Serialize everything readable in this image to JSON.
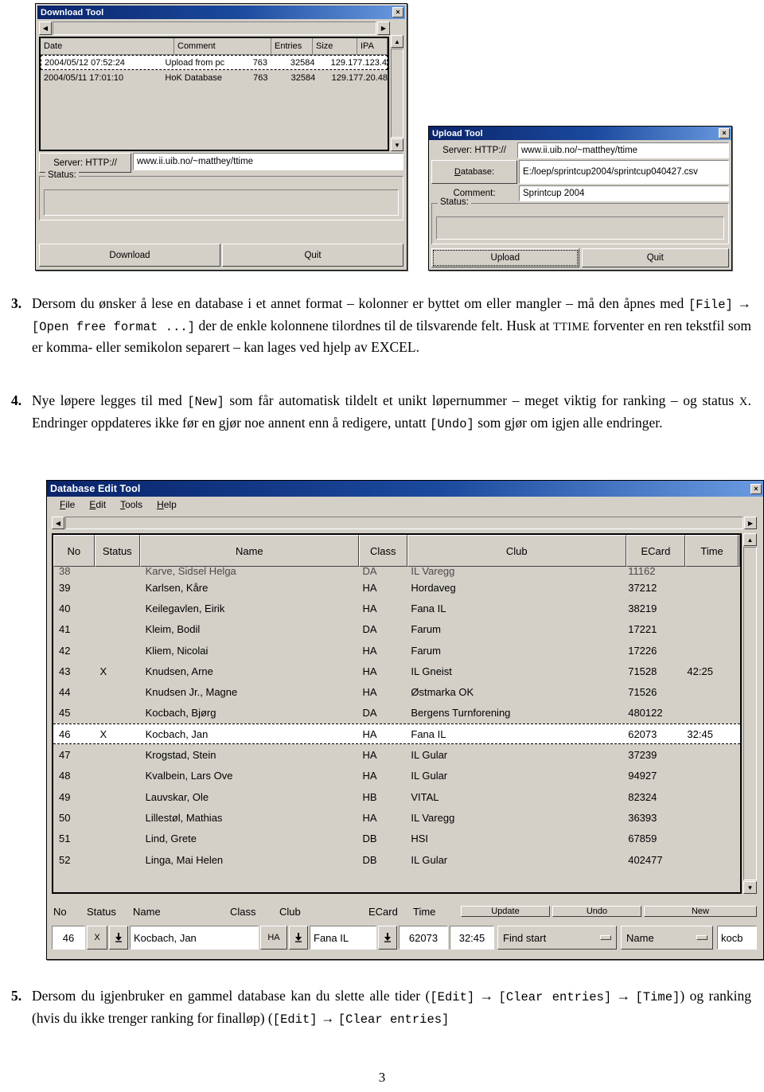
{
  "download_tool": {
    "title": "Download Tool",
    "close_label": "×",
    "columns": [
      "Date",
      "Comment",
      "Entries",
      "Size",
      "IPA"
    ],
    "rows": [
      {
        "date": "2004/05/12 07:52:24",
        "comment": "Upload from pc",
        "entries": "763",
        "size": "32584",
        "ipa": "129.177.123.4",
        "selected": true
      },
      {
        "date": "2004/05/11 17:01:10",
        "comment": "HoK Database",
        "entries": "763",
        "size": "32584",
        "ipa": "129.177.20.48",
        "selected": false
      }
    ],
    "server_label": "Server: HTTP://",
    "server_value": "www.ii.uib.no/~matthey/ttime",
    "status_label": "Status:",
    "status_value": "",
    "download_button": "Download",
    "quit_button": "Quit"
  },
  "upload_tool": {
    "title": "Upload Tool",
    "close_label": "×",
    "server_label": "Server: HTTP://",
    "server_value": "www.ii.uib.no/~matthey/ttime",
    "database_label": "Database:",
    "database_value": "E:/loep/sprintcup2004/sprintcup040427.csv",
    "comment_label": "Comment:",
    "comment_value": "Sprintcup 2004",
    "status_label": "Status:",
    "status_value": "",
    "upload_button": "Upload",
    "quit_button": "Quit"
  },
  "para3": {
    "number": "3.",
    "seg1": "Dersom du ønsker å lese en database i et annet format – kolonner er byttet om eller mangler – må den åpnes med ",
    "code1": "[File]",
    "arrow1": " → ",
    "code2": "[Open free format ...]",
    "seg2": " der de enkle kolonnene tilordnes til de tilsvarende felt. Husk at ",
    "sc1": "TTIME",
    "seg3": " forventer en ren tekstfil som er komma- eller semikolon separert – kan lages ved hjelp av ",
    "sc2": "EXCEL",
    "seg4": "."
  },
  "para4": {
    "number": "4.",
    "seg1": "Nye løpere legges til med ",
    "code1": "[New]",
    "seg2": " som får automatisk tildelt et unikt løpernummer – meget viktig for ranking – og status ",
    "sc1": "X",
    "seg3": ". Endringer oppdateres ikke før en gjør noe annent enn å redigere, untatt ",
    "code2": "[Undo]",
    "seg4": " som gjør om igjen alle endringer."
  },
  "para5": {
    "number": "5.",
    "seg1": "Dersom du igjenbruker en gammel database kan du slette alle tider (",
    "code1": "[Edit]",
    "arrow1": " → ",
    "code2": "[Clear entries]",
    "arrow2": " → ",
    "code3": "[Time]",
    "seg2": ") og ranking (hvis du ikke trenger ranking for finalløp) (",
    "code4": "[Edit]",
    "arrow3": " → ",
    "code5": "[Clear entries]"
  },
  "db_tool": {
    "title": "Database Edit Tool",
    "close_label": "×",
    "menu": [
      {
        "pre": "",
        "hot": "F",
        "post": "ile"
      },
      {
        "pre": "",
        "hot": "E",
        "post": "dit"
      },
      {
        "pre": "",
        "hot": "T",
        "post": "ools"
      },
      {
        "pre": "",
        "hot": "H",
        "post": "elp"
      }
    ],
    "columns": [
      "No",
      "Status",
      "Name",
      "Class",
      "Club",
      "ECard",
      "Time",
      ""
    ],
    "rows": [
      {
        "no": "38",
        "status": "",
        "name": "Karve, Sidsel Helga",
        "class": "DA",
        "club": "IL Varegg",
        "ecard": "11162",
        "time": "",
        "selected": false,
        "clipped": true
      },
      {
        "no": "39",
        "status": "",
        "name": "Karlsen, Kåre",
        "class": "HA",
        "club": "Hordaveg",
        "ecard": "37212",
        "time": "",
        "selected": false,
        "clipped": false
      },
      {
        "no": "40",
        "status": "",
        "name": "Keilegavlen, Eirik",
        "class": "HA",
        "club": "Fana IL",
        "ecard": "38219",
        "time": "",
        "selected": false,
        "clipped": false
      },
      {
        "no": "41",
        "status": "",
        "name": "Kleim, Bodil",
        "class": "DA",
        "club": "Farum",
        "ecard": "17221",
        "time": "",
        "selected": false,
        "clipped": false
      },
      {
        "no": "42",
        "status": "",
        "name": "Kliem, Nicolai",
        "class": "HA",
        "club": "Farum",
        "ecard": "17226",
        "time": "",
        "selected": false,
        "clipped": false
      },
      {
        "no": "43",
        "status": "X",
        "name": "Knudsen, Arne",
        "class": "HA",
        "club": "IL Gneist",
        "ecard": "71528",
        "time": "42:25",
        "selected": false,
        "clipped": false
      },
      {
        "no": "44",
        "status": "",
        "name": "Knudsen Jr., Magne",
        "class": "HA",
        "club": "Østmarka OK",
        "ecard": "71526",
        "time": "",
        "selected": false,
        "clipped": false
      },
      {
        "no": "45",
        "status": "",
        "name": "Kocbach, Bjørg",
        "class": "DA",
        "club": "Bergens Turnforening",
        "ecard": "480122",
        "time": "",
        "selected": false,
        "clipped": false
      },
      {
        "no": "46",
        "status": "X",
        "name": "Kocbach, Jan",
        "class": "HA",
        "club": "Fana IL",
        "ecard": "62073",
        "time": "32:45",
        "selected": true,
        "clipped": false
      },
      {
        "no": "47",
        "status": "",
        "name": "Krogstad, Stein",
        "class": "HA",
        "club": "IL Gular",
        "ecard": "37239",
        "time": "",
        "selected": false,
        "clipped": false
      },
      {
        "no": "48",
        "status": "",
        "name": "Kvalbein, Lars Ove",
        "class": "HA",
        "club": "IL Gular",
        "ecard": "94927",
        "time": "",
        "selected": false,
        "clipped": false
      },
      {
        "no": "49",
        "status": "",
        "name": "Lauvskar, Ole",
        "class": "HB",
        "club": "VITAL",
        "ecard": "82324",
        "time": "",
        "selected": false,
        "clipped": false
      },
      {
        "no": "50",
        "status": "",
        "name": "Lillestøl, Mathias",
        "class": "HA",
        "club": "IL Varegg",
        "ecard": "36393",
        "time": "",
        "selected": false,
        "clipped": false
      },
      {
        "no": "51",
        "status": "",
        "name": "Lind, Grete",
        "class": "DB",
        "club": "HSI",
        "ecard": "67859",
        "time": "",
        "selected": false,
        "clipped": false
      },
      {
        "no": "52",
        "status": "",
        "name": "Linga, Mai Helen",
        "class": "DB",
        "club": "IL Gular",
        "ecard": "402477",
        "time": "",
        "selected": false,
        "clipped": false
      }
    ],
    "editbar": {
      "labels": [
        "No",
        "Status",
        "Name",
        "Class",
        "Club",
        "ECard",
        "Time"
      ],
      "no_value": "46",
      "status_value": "X",
      "name_value": "Kocbach, Jan",
      "class_value": "HA",
      "club_value": "Fana IL",
      "ecard_value": "62073",
      "time_value": "32:45",
      "update_button": "Update",
      "undo_button": "Undo",
      "new_button": "New",
      "find_mode": "Find start",
      "find_field": "Name",
      "find_value": "kocb"
    }
  },
  "page_number": "3",
  "colors": {
    "titlebar_start": "#0a246a",
    "titlebar_end": "#6a9ae0",
    "face": "#d4d0c8",
    "field": "#ffffff"
  }
}
